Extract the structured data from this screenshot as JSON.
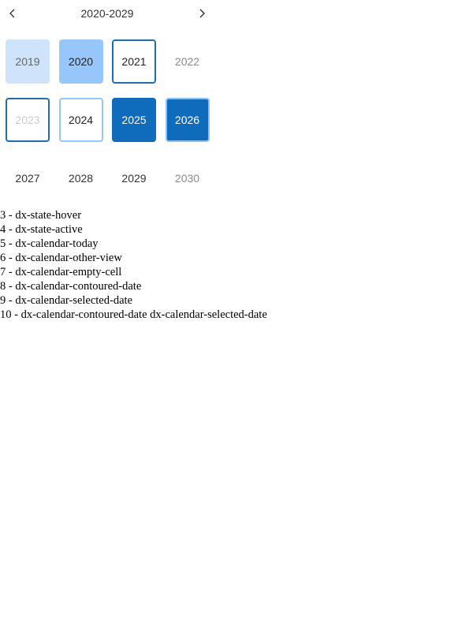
{
  "calendar": {
    "caption": "2020-2029",
    "prev_icon": "chevron-left-icon",
    "next_icon": "chevron-right-icon",
    "rows": [
      [
        {
          "label": "2019",
          "state": "hover"
        },
        {
          "label": "2020",
          "state": "active"
        },
        {
          "label": "2021",
          "state": "today"
        },
        {
          "label": "2022",
          "state": "other"
        }
      ],
      [
        {
          "label": "2023",
          "state": "empty"
        },
        {
          "label": "2024",
          "state": "contoured"
        },
        {
          "label": "2025",
          "state": "selected"
        },
        {
          "label": "2026",
          "state": "contoured-selected"
        }
      ],
      [
        {
          "label": "2027",
          "state": "normal"
        },
        {
          "label": "2028",
          "state": "normal"
        },
        {
          "label": "2029",
          "state": "normal"
        },
        {
          "label": "2030",
          "state": "other"
        }
      ]
    ]
  },
  "legend": [
    "3 - dx-state-hover",
    "4 - dx-state-active",
    "5 - dx-calendar-today",
    "6 - dx-calendar-other-view",
    "7 - dx-calendar-empty-cell",
    "8 - dx-calendar-contoured-date",
    "9 - dx-calendar-selected-date",
    "10 - dx-calendar-contoured-date dx-calendar-selected-date"
  ],
  "colors": {
    "hover": "#cfe4fb",
    "active": "#97c6fb",
    "today_border": "#1b6fb8",
    "selected": "#0f6cbd",
    "contoured_border": "#97c6fb"
  }
}
